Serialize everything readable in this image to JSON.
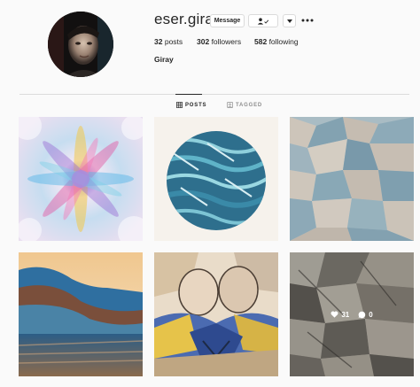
{
  "profile": {
    "username": "eser.giray",
    "full_name": "Giray",
    "avatar_icon": "profile-photo",
    "message_label": "Message",
    "follow_icon": "person-check-icon",
    "dropdown_icon": "chevron-down-icon",
    "more_icon": "more-icon"
  },
  "stats": {
    "posts_count": "32",
    "posts_label": "posts",
    "followers_count": "302",
    "followers_label": "followers",
    "following_count": "582",
    "following_label": "following"
  },
  "tabs": [
    {
      "label": "POSTS",
      "icon": "grid-icon",
      "active": true
    },
    {
      "label": "TAGGED",
      "icon": "tag-icon",
      "active": false
    }
  ],
  "posts": [
    {
      "kind": "kaleidoscope"
    },
    {
      "kind": "blue-circle"
    },
    {
      "kind": "blue-mosaic"
    },
    {
      "kind": "landscape"
    },
    {
      "kind": "cubist-figures"
    },
    {
      "kind": "gray-cubist",
      "hover": {
        "likes": "31",
        "comments": "0"
      }
    }
  ],
  "colors": {
    "text": "#262626",
    "muted": "#8e8e8e",
    "border": "#dbdbdb",
    "background": "#fafafa"
  }
}
